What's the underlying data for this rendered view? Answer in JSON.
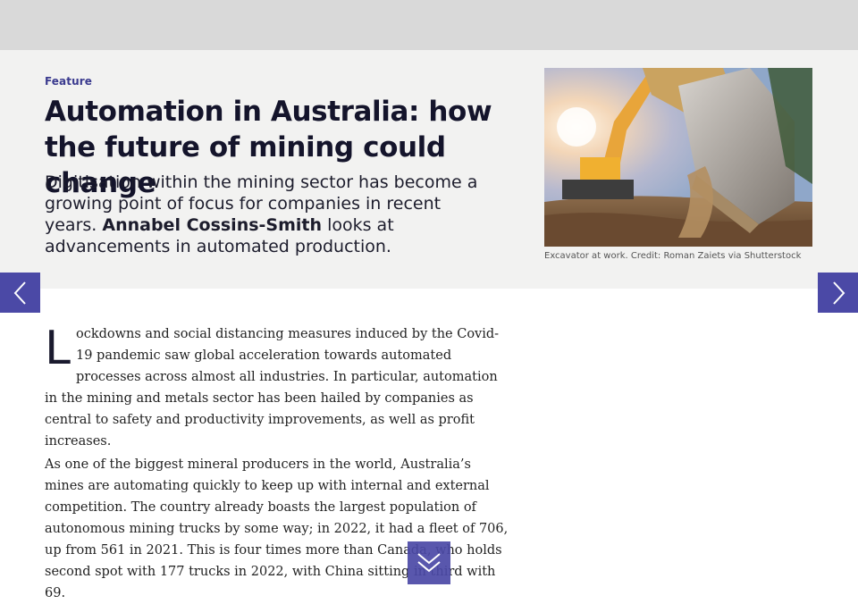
{
  "article": {
    "category": "Feature",
    "title": "Automation in Australia: how the future of mining could change",
    "standfirst_before": "Digitisation within the mining sector has become a growing point of focus for companies in recent years.",
    "author": "Annabel Cossins-Smith",
    "standfirst_after": "looks at advancements in automated production.",
    "image_caption": "Excavator at work. Credit: Roman Zaiets via Shutterstock",
    "dropcap": "L",
    "paragraph1_rest": "ockdowns and social distancing measures induced by the Covid-19 pandemic saw global acceleration towards automated processes across almost all industries. In particular, automation in the mining and metals sector has been hailed by companies as central to safety and productivity improvements, as well as profit increases.",
    "paragraph2": "As one of the biggest mineral producers in the world, Australia’s mines are automating quickly to keep up with internal and external competition. The country already boasts the largest population of autonomous mining trucks by some way; in 2022, it had a fleet of 706, up from 561 in 2021. This is four times more than Canada, who holds second spot with 177 trucks in 2022, with China sitting in third with 69."
  },
  "navigation": {
    "prev_icon": "chevron-left-icon",
    "next_icon": "chevron-right-icon",
    "scroll_icon": "double-chevron-down-icon"
  },
  "colors": {
    "accent": "#4b49a6",
    "hero_background": "#f2f2f1",
    "top_bar": "#d9d9d9"
  }
}
